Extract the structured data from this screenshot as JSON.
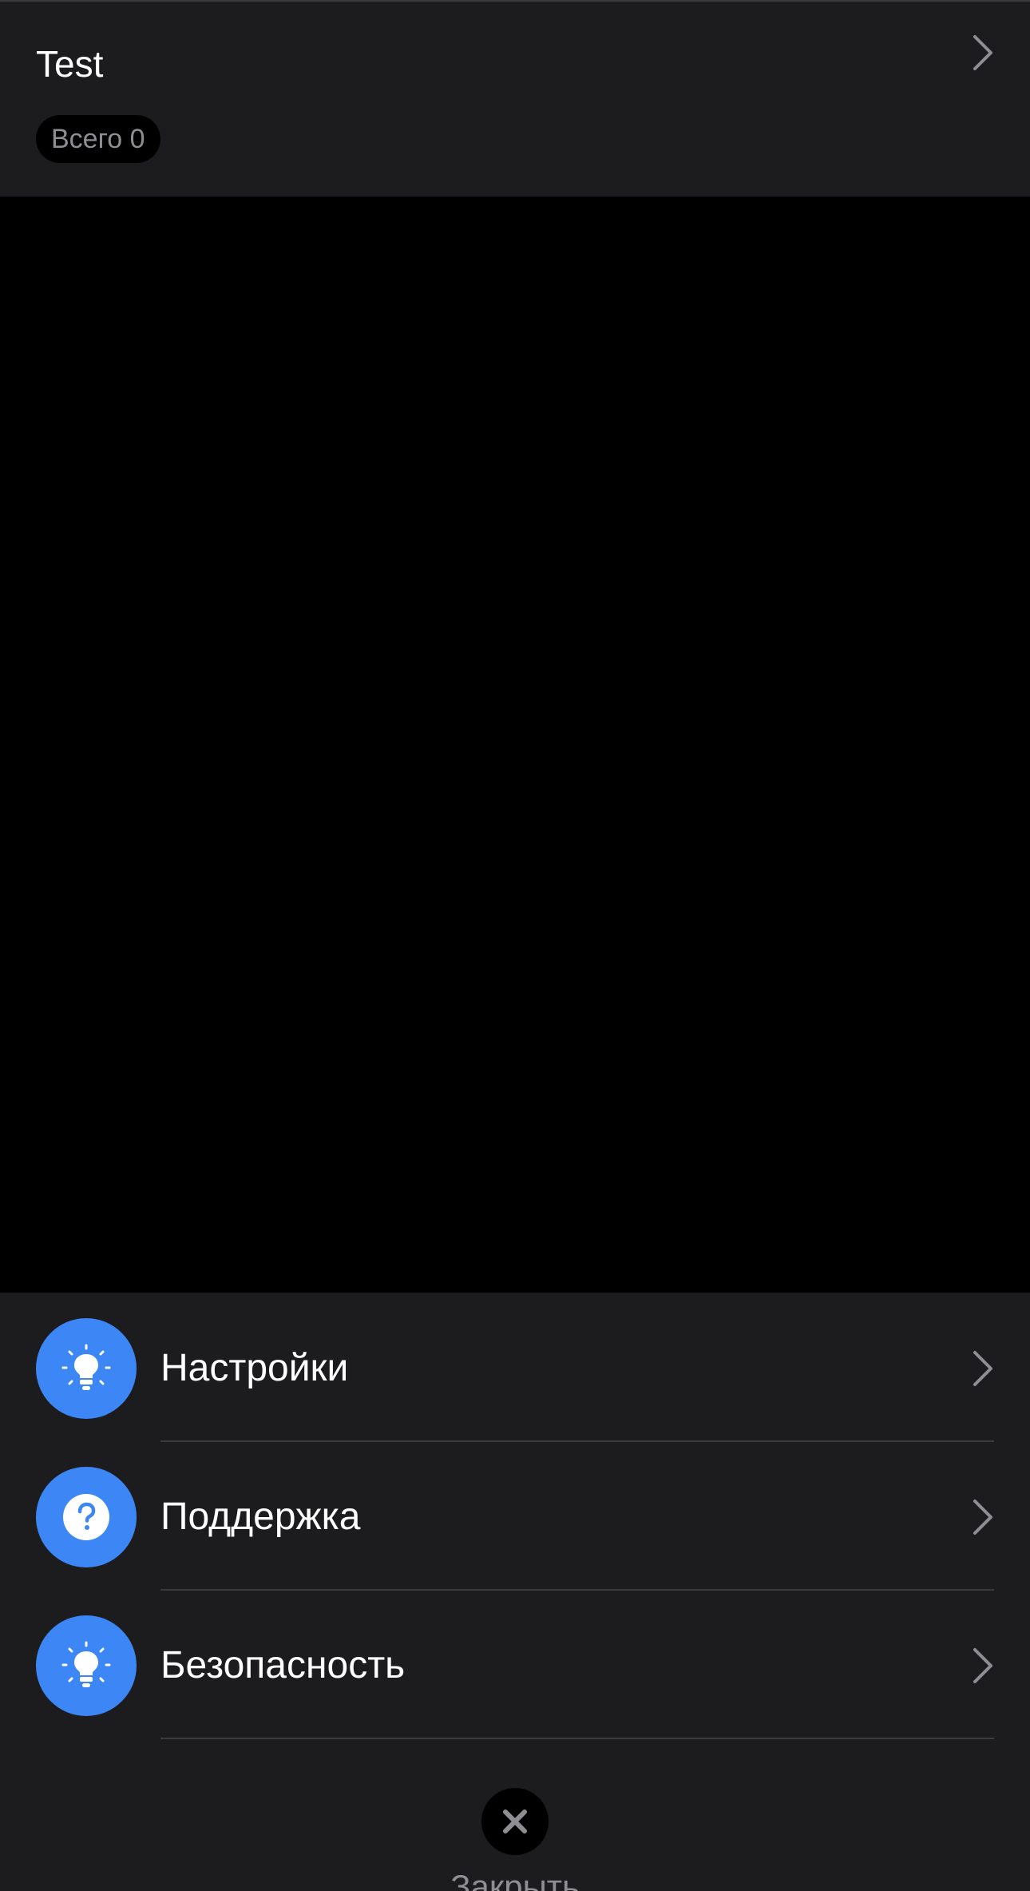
{
  "colors": {
    "sheet_background": "#1c1c1e",
    "screen_background": "#000000",
    "accent_blue": "#3c87f5",
    "secondary_text": "#8e8e93",
    "chevron": "#8e8e93",
    "divider": "#3a3a3c"
  },
  "header": {
    "title": "Test",
    "chevron_icon": "chevron-right-icon",
    "badge": {
      "label": "Всего 0"
    }
  },
  "menu": {
    "items": [
      {
        "label": "Настройки",
        "icon": "lightbulb-icon"
      },
      {
        "label": "Поддержка",
        "icon": "question-circle-icon"
      },
      {
        "label": "Безопасность",
        "icon": "lightbulb-icon"
      }
    ]
  },
  "close": {
    "icon": "close-icon",
    "label": "Закрыть"
  }
}
